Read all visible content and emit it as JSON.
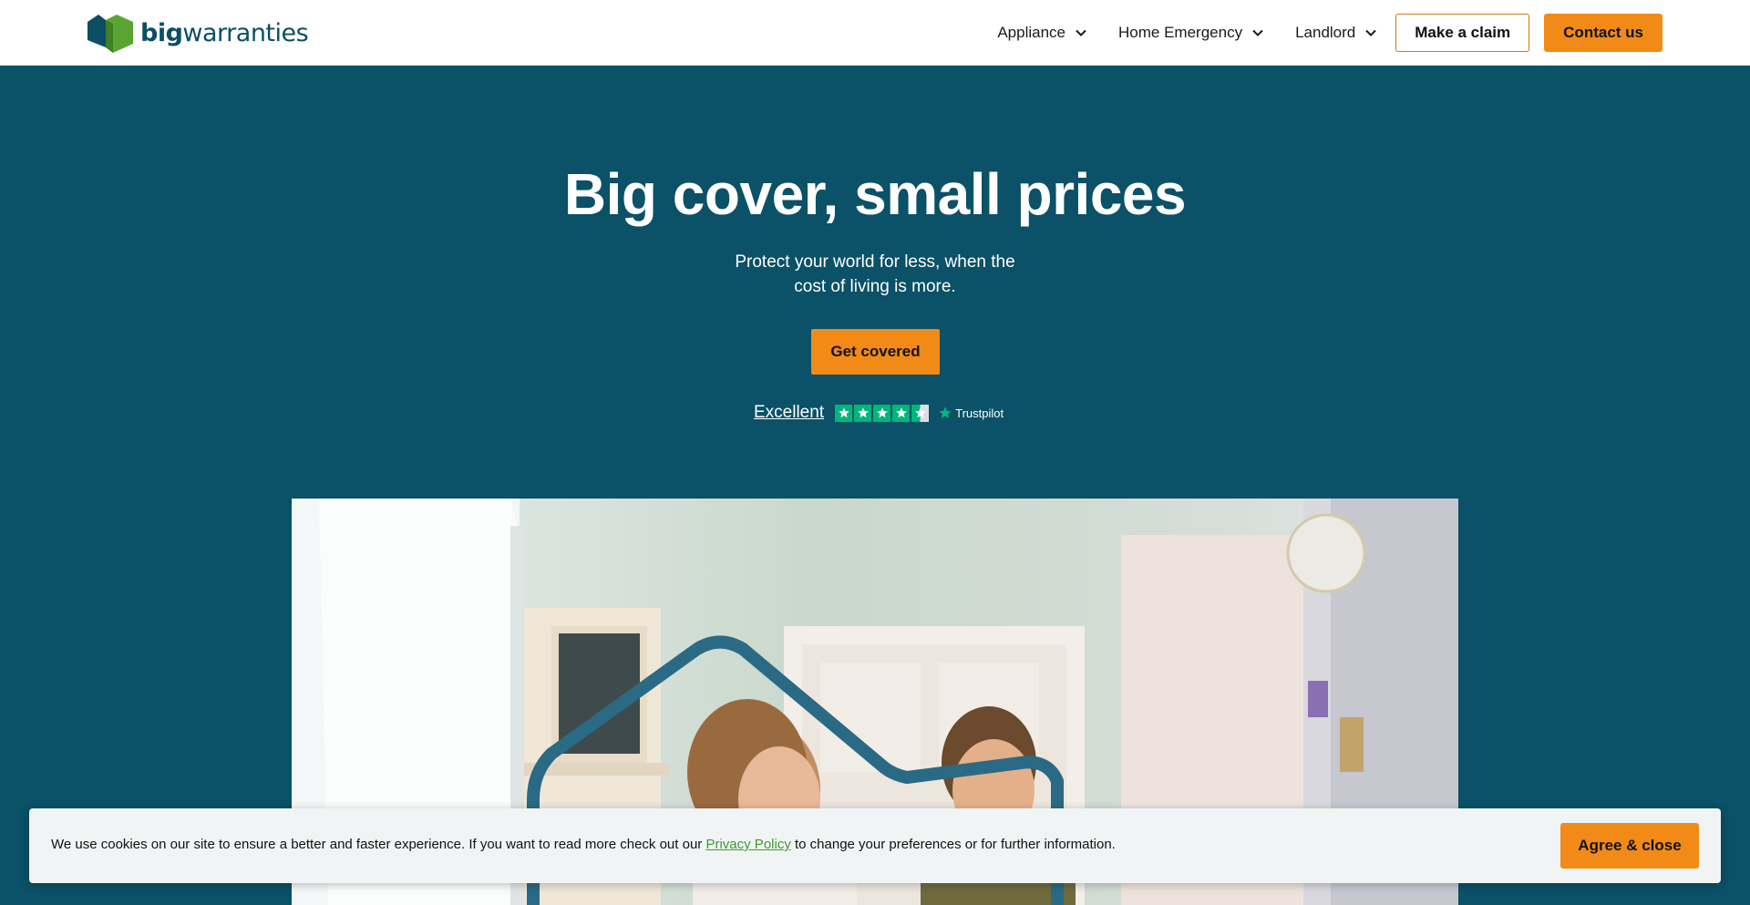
{
  "brand": {
    "name_part1": "big",
    "name_part2": "warranties",
    "logo_colors": [
      "#0b4e66",
      "#5aa532"
    ]
  },
  "nav": {
    "items": [
      {
        "label": "Appliance",
        "icon": "chevron-down-icon"
      },
      {
        "label": "Home Emergency",
        "icon": "chevron-down-icon"
      },
      {
        "label": "Landlord",
        "icon": "chevron-down-icon"
      }
    ],
    "claim_label": "Make a claim",
    "contact_label": "Contact us"
  },
  "hero": {
    "title": "Big cover, small prices",
    "subtitle_line1": "Protect your world for less, when the",
    "subtitle_line2": "cost of living is more.",
    "cta_label": "Get covered"
  },
  "trustpilot": {
    "rating_word": "Excellent",
    "stars": 4.5,
    "brand": "Trustpilot",
    "star_color": "#00b67a"
  },
  "cookie": {
    "text_before": "We use cookies on our site to ensure a better and faster experience. If you want to read more check out our ",
    "link_text": "Privacy Policy",
    "text_after": " to change your preferences or for further information.",
    "button_label": "Agree & close"
  },
  "colors": {
    "hero_bg": "#0b5167",
    "accent": "#f28a17",
    "link": "#3f9b2b"
  }
}
